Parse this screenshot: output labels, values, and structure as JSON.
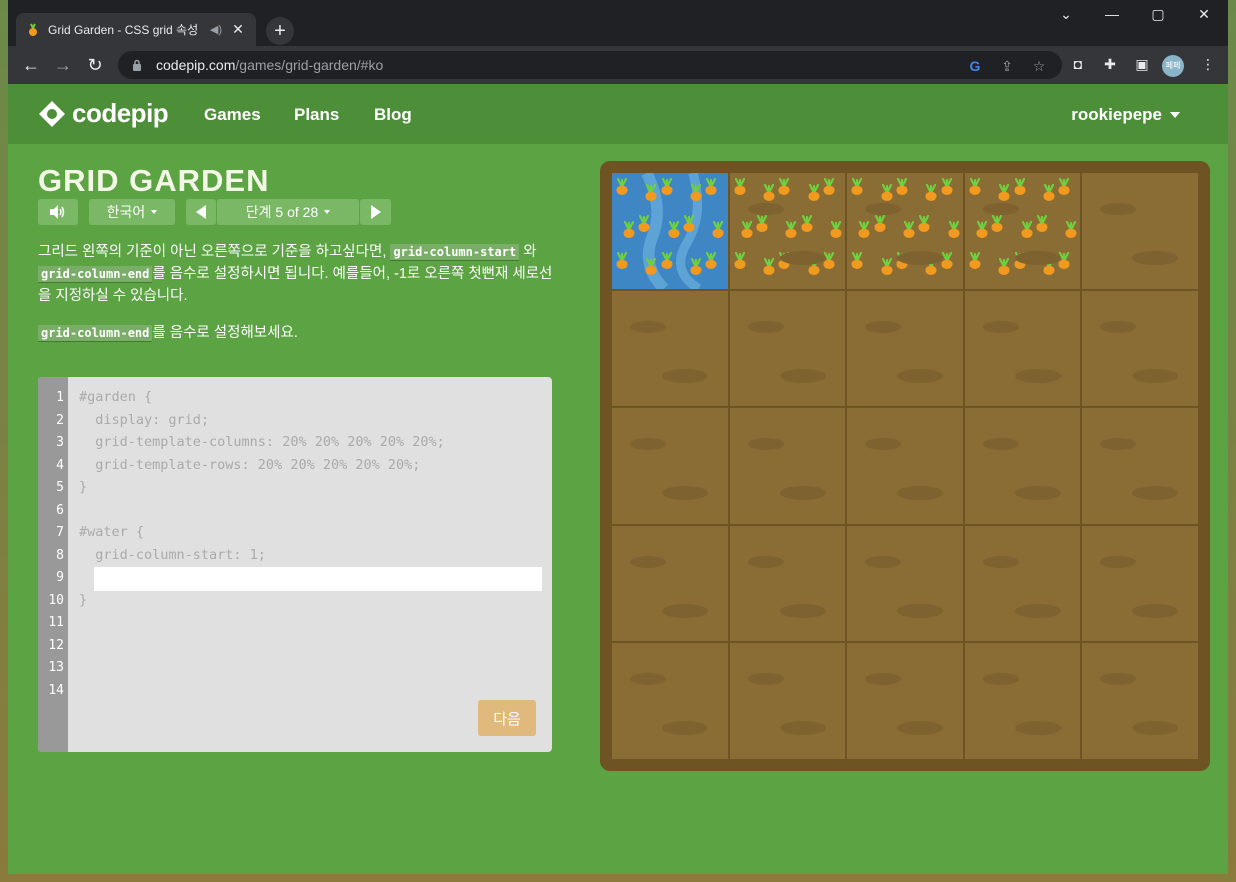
{
  "browser": {
    "tab_title": "Grid Garden - CSS grid 속성",
    "tab_close": "✕",
    "new_tab": "+",
    "url_host": "codepip.com",
    "url_path": "/games/grid-garden/#ko",
    "profile_label": "페페",
    "icons": [
      "minimize-icon",
      "maximize-icon",
      "close-window-icon",
      "back-icon",
      "forward-icon",
      "reload-icon",
      "lock-icon",
      "google-icon",
      "share-icon",
      "star-icon",
      "camera-icon",
      "extensions-icon",
      "sidepanel-icon",
      "menu-icon"
    ]
  },
  "site": {
    "logo_text": "codepip",
    "nav": [
      "Games",
      "Plans",
      "Blog"
    ],
    "user": "rookiepepe"
  },
  "game": {
    "title": "GRID GARDEN",
    "language": "한국어",
    "level": "단계 5 of 28",
    "instruction_1": "그리드 왼쪽의 기준이 아닌 오른쪽으로 기준을 하고싶다면, ",
    "code_1": "grid-column-start",
    "instruction_2": " 와 ",
    "code_2": "grid-column-end",
    "instruction_3": "를 음수로 설정하시면 됩니다. 예를들어, -1로 오른쪽 첫뻔재 세로선을 지정하실 수 있습니다.",
    "code_3": "grid-column-end",
    "instruction_4": "를 음수로 설정해보세요.",
    "next_button": "다음"
  },
  "editor": {
    "line_numbers": [
      "1",
      "2",
      "3",
      "4",
      "5",
      "6",
      "7",
      "8",
      "9",
      "10",
      "11",
      "12",
      "13",
      "14"
    ],
    "lines": [
      "#garden {",
      "  display: grid;",
      "  grid-template-columns: 20% 20% 20% 20% 20%;",
      "  grid-template-rows: 20% 20% 20% 20% 20%;",
      "}",
      "",
      "#water {",
      "  grid-column-start: 1;",
      "",
      "}"
    ],
    "input_value": ""
  },
  "garden": {
    "water_cells": 1,
    "carrot_cells": 3,
    "soil_cells": 21
  },
  "colors": {
    "page_bg": "#5ba343",
    "header_bg": "#4d8e39",
    "soil": "#8a6d34",
    "water": "#3f86c4",
    "frame": "#6e5323",
    "carrot": "#f19a1f",
    "leaf": "#6fcf3e"
  }
}
